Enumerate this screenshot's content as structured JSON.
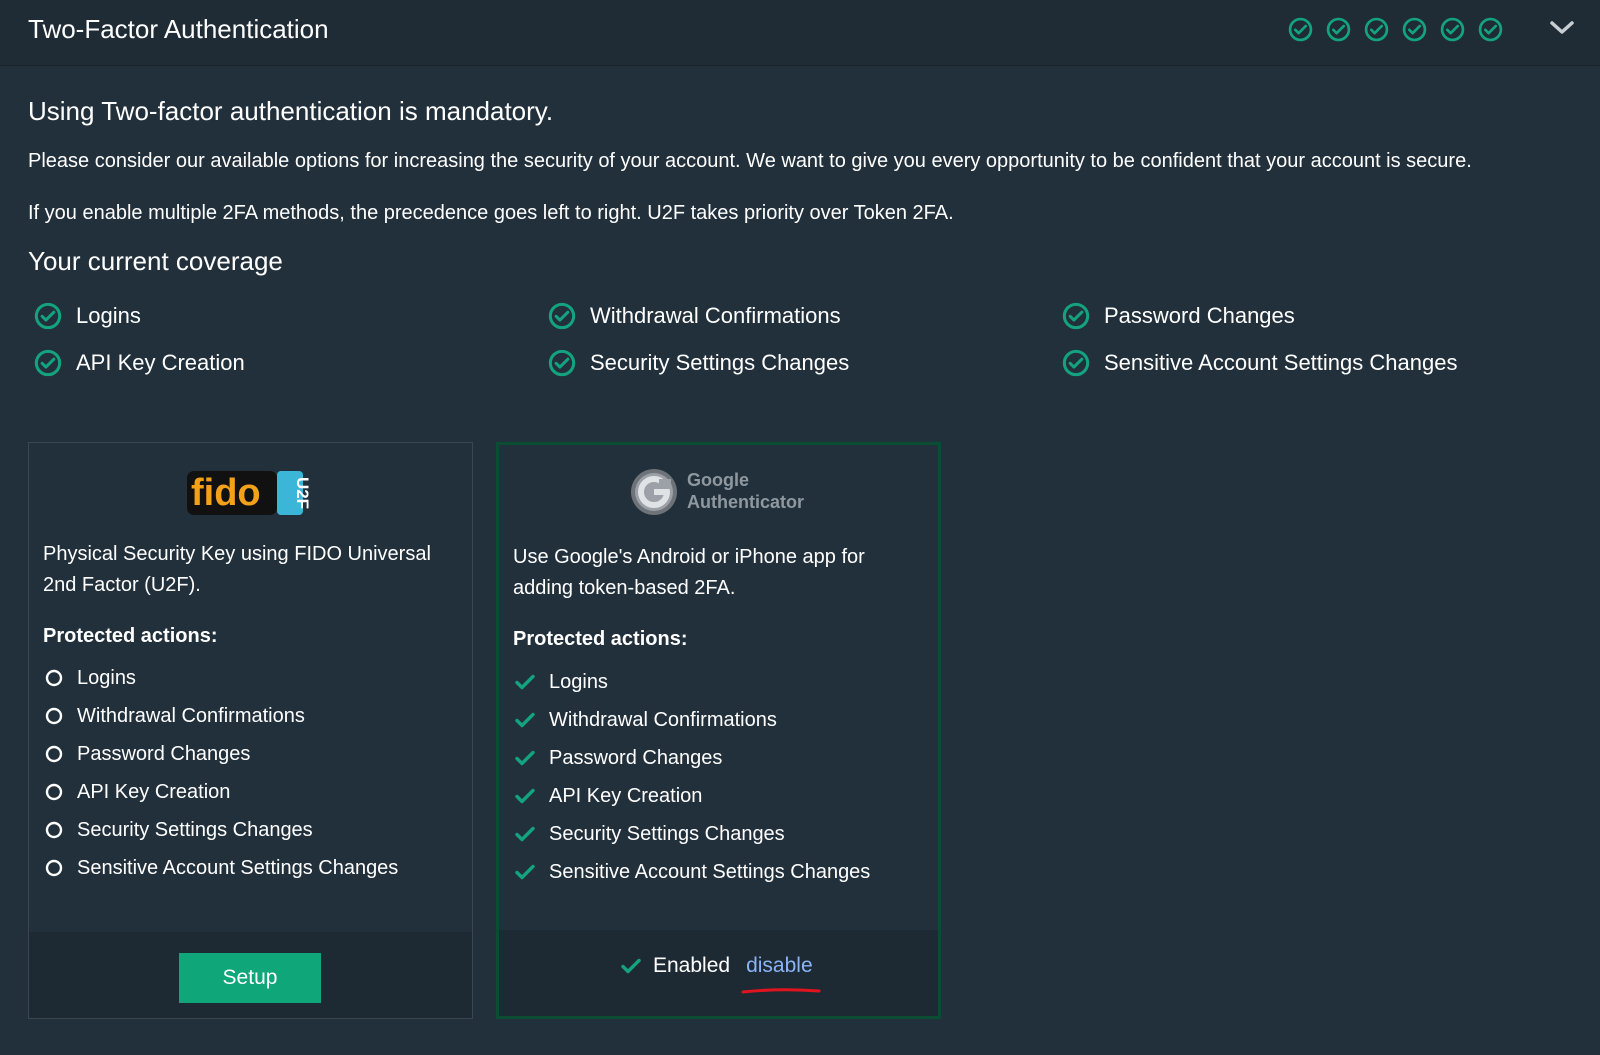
{
  "header": {
    "title": "Two-Factor Authentication",
    "status_icons": [
      "check-circle-icon",
      "check-circle-icon",
      "check-circle-icon",
      "check-circle-icon",
      "check-circle-icon",
      "check-circle-icon"
    ],
    "collapse_icon": "chevron-down-icon"
  },
  "intro": {
    "lead": "Using Two-factor authentication is mandatory.",
    "paragraph_1": "Please consider our available options for increasing the security of your account. We want to give you every opportunity to be confident that your account is secure.",
    "paragraph_2": "If you enable multiple 2FA methods, the precedence goes left to right. U2F takes priority over Token 2FA."
  },
  "coverage": {
    "title": "Your current coverage",
    "items": [
      {
        "label": "Logins",
        "icon": "check-circle-icon"
      },
      {
        "label": "Withdrawal Confirmations",
        "icon": "check-circle-icon"
      },
      {
        "label": "Password Changes",
        "icon": "check-circle-icon"
      },
      {
        "label": "API Key Creation",
        "icon": "check-circle-icon"
      },
      {
        "label": "Security Settings Changes",
        "icon": "check-circle-icon"
      },
      {
        "label": "Sensitive Account Settings Changes",
        "icon": "check-circle-icon"
      }
    ]
  },
  "methods": [
    {
      "logo": "fido-u2f-logo",
      "logo_text": "fido",
      "logo_badge": "U2F",
      "description": "Physical Security Key using FIDO Universal 2nd Factor (U2F).",
      "protected_title": "Protected actions:",
      "actions": [
        {
          "label": "Logins",
          "icon": "empty-circle-icon"
        },
        {
          "label": "Withdrawal Confirmations",
          "icon": "empty-circle-icon"
        },
        {
          "label": "Password Changes",
          "icon": "empty-circle-icon"
        },
        {
          "label": "API Key Creation",
          "icon": "empty-circle-icon"
        },
        {
          "label": "Security Settings Changes",
          "icon": "empty-circle-icon"
        },
        {
          "label": "Sensitive Account Settings Changes",
          "icon": "empty-circle-icon"
        }
      ],
      "button_label": "Setup"
    },
    {
      "logo": "google-authenticator-logo",
      "logo_line_1": "Google",
      "logo_line_2": "Authenticator",
      "description": "Use Google's Android or iPhone app for adding token-based 2FA.",
      "protected_title": "Protected actions:",
      "actions": [
        {
          "label": "Logins",
          "icon": "check-icon"
        },
        {
          "label": "Withdrawal Confirmations",
          "icon": "check-icon"
        },
        {
          "label": "Password Changes",
          "icon": "check-icon"
        },
        {
          "label": "API Key Creation",
          "icon": "check-icon"
        },
        {
          "label": "Security Settings Changes",
          "icon": "check-icon"
        },
        {
          "label": "Sensitive Account Settings Changes",
          "icon": "check-icon"
        }
      ],
      "status_label": "Enabled",
      "disable_label": "disable"
    }
  ],
  "colors": {
    "background": "#22303b",
    "header_background": "#1f2b35",
    "accent_green": "#14a37f",
    "button_green": "#0fa67a",
    "link_blue": "#8ab4f8",
    "active_card_border": "#0a4d33",
    "annotation_red": "#e0141e"
  }
}
